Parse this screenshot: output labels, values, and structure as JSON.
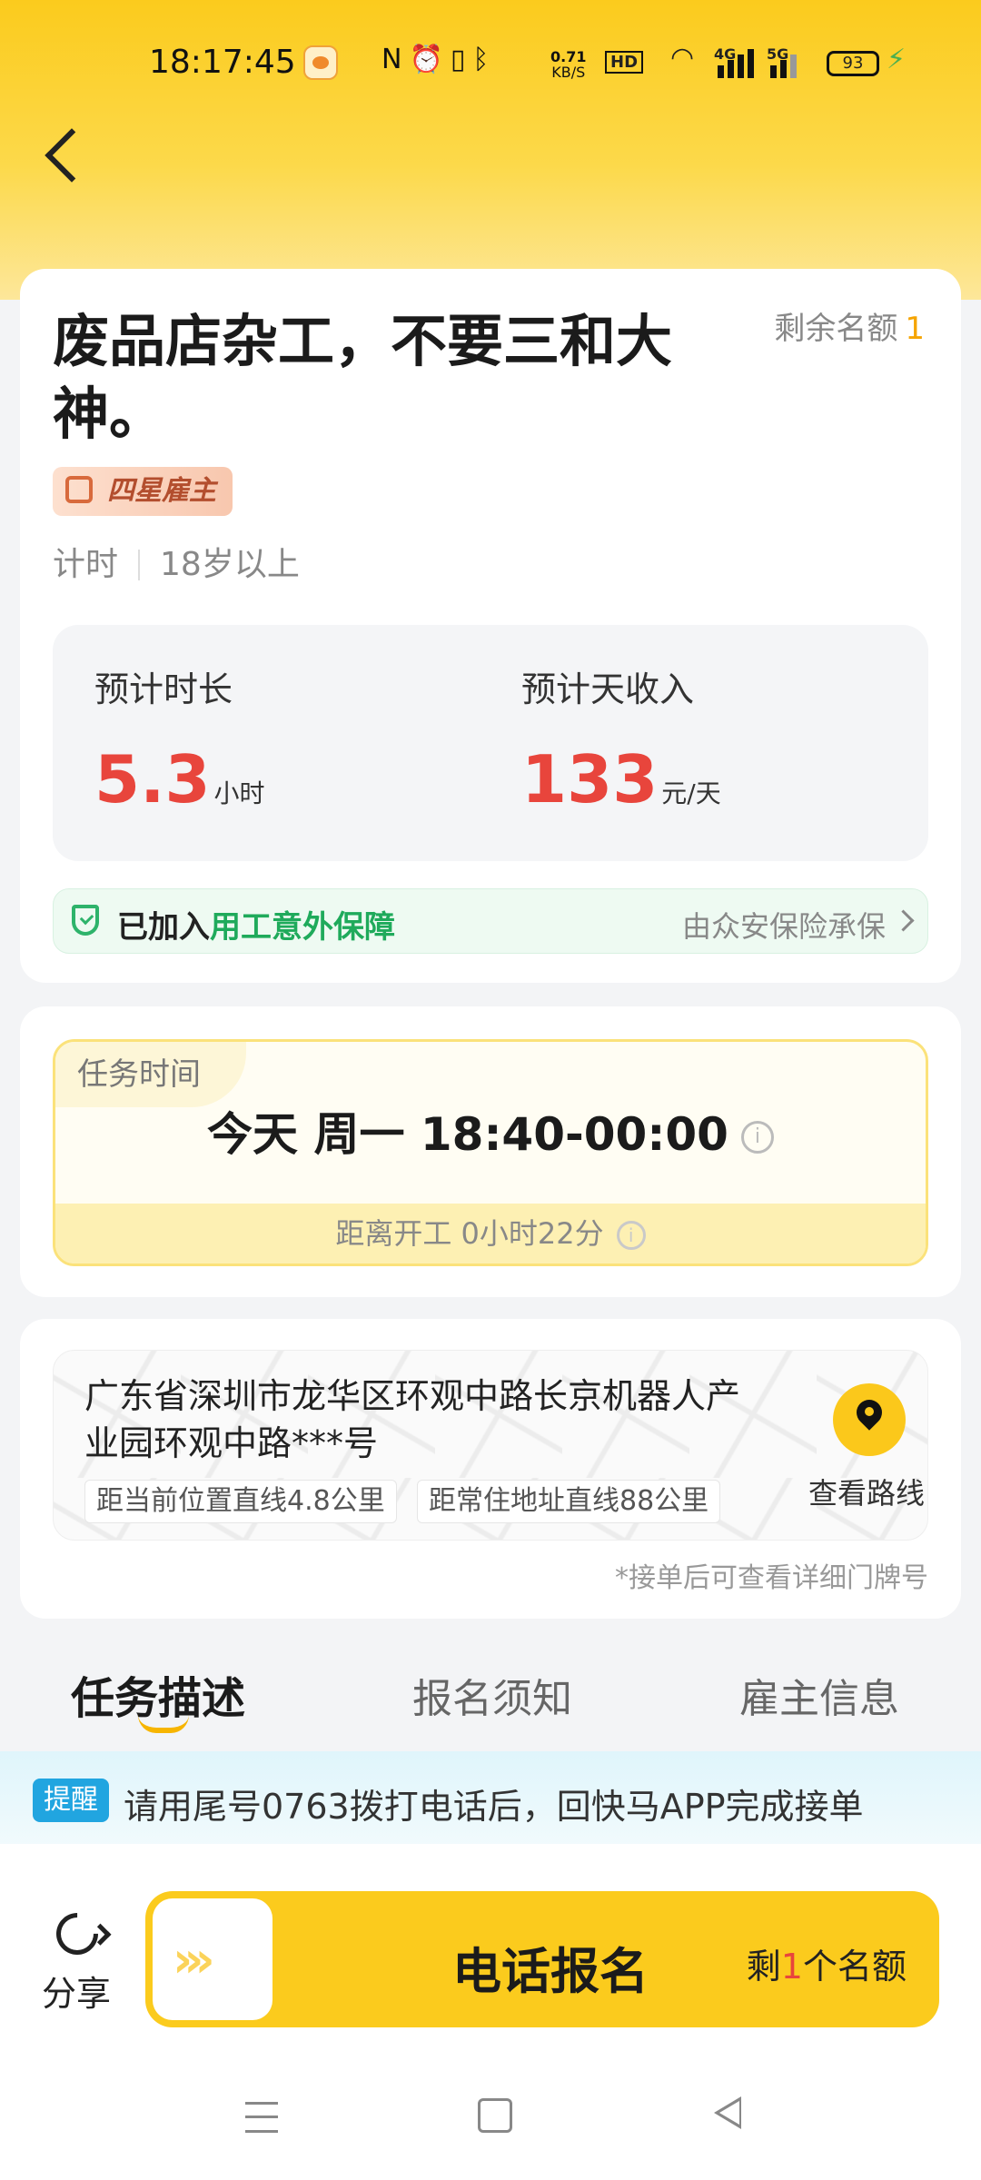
{
  "status_bar": {
    "time": "18:17:45",
    "network_speed_value": "0.71",
    "network_speed_unit": "KB/S",
    "hd_label": "HD",
    "sim1_label": "4G",
    "sim2_label": "5G",
    "battery": "93",
    "icons": [
      "nfc-icon",
      "alarm-icon",
      "vibrate-icon",
      "bluetooth-icon",
      "wifi-icon",
      "signal-icon",
      "battery-icon",
      "charging-icon"
    ]
  },
  "job": {
    "title": "废品店杂工，不要三和大神。",
    "quota_label": "剩余名额",
    "quota_value": "1",
    "employer_badge": "四星雇主",
    "tags": [
      "计时",
      "18岁以上"
    ],
    "duration_label": "预计时长",
    "duration_value": "5.3",
    "duration_unit": "小时",
    "income_label": "预计天收入",
    "income_value": "133",
    "income_unit": "元/天",
    "insurance_prefix": "已加入",
    "insurance_name": "用工意外保障",
    "insurance_provider": "由众安保险承保"
  },
  "task_time": {
    "label": "任务时间",
    "time": "今天 周一 18:40-00:00",
    "countdown": "距离开工 0小时22分"
  },
  "location": {
    "address": "广东省深圳市龙华区环观中路长京机器人产业园环观中路***号",
    "distance_current": "距当前位置直线4.8公里",
    "distance_home": "距常住地址直线88公里",
    "route_label": "查看路线",
    "note": "*接单后可查看详细门牌号"
  },
  "tabs": [
    {
      "label": "任务描述",
      "active": true
    },
    {
      "label": "报名须知",
      "active": false
    },
    {
      "label": "雇主信息",
      "active": false
    }
  ],
  "reminder": {
    "tag": "提醒",
    "text": "请用尾号0763拨打电话后，回快马APP完成接单"
  },
  "bottom_bar": {
    "share_label": "分享",
    "cta_label": "电话报名",
    "remaining_prefix": "剩",
    "remaining_count": "1",
    "remaining_suffix": "个名额"
  },
  "colors": {
    "brand_yellow": "#fbcb1d",
    "price_red": "#e8453c",
    "insurance_green": "#1faa5b",
    "reminder_blue": "#21a5e0"
  }
}
